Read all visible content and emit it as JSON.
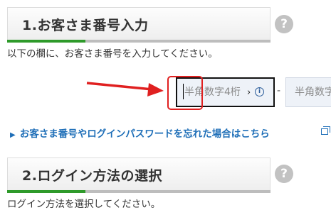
{
  "section1": {
    "title": "1.お客さま番号入力",
    "help": "?",
    "description": "以下の欄に、お客さま番号を入力してください。"
  },
  "customer_number": {
    "field1_placeholder": "半角数字4桁",
    "ime_mode": "›",
    "info_glyph": "i",
    "separator": "-",
    "field2_placeholder": "半角数字"
  },
  "forgot_link": {
    "bullet": "▶",
    "label": "お客さま番号やログインパスワードを忘れた場合はこちら"
  },
  "section2": {
    "title": "2.ログイン方法の選択",
    "help": "?",
    "description": "ログイン方法を選択してください。"
  },
  "colors": {
    "accent_green": "#2e9a2a",
    "link_blue": "#1f6fb8",
    "annotation_red": "#e02020"
  }
}
